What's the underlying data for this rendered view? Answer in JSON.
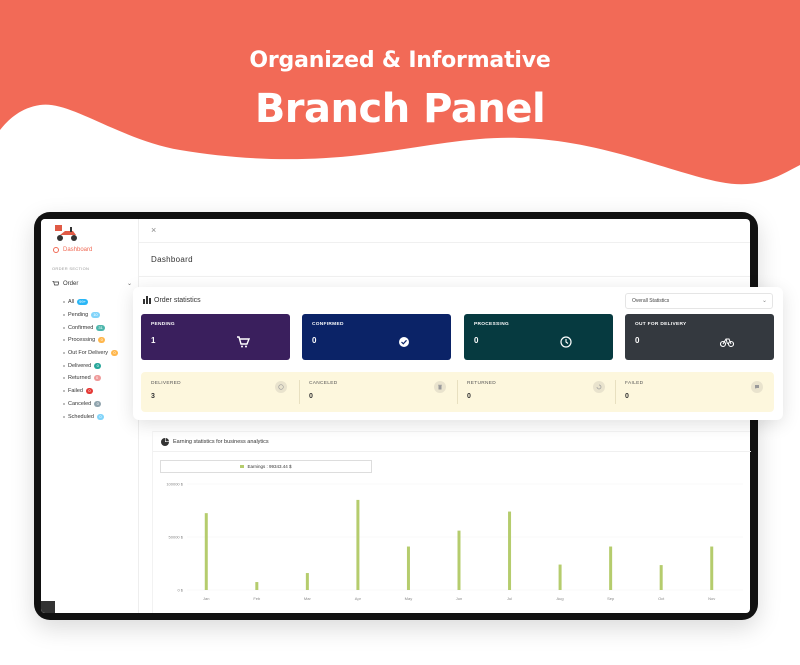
{
  "hero": {
    "subtitle": "Organized & Informative",
    "title": "Branch Panel"
  },
  "colors": {
    "brand": "#f26a57",
    "pending": "#3a1f5d",
    "confirmed": "#0b2367",
    "processing": "#063a40",
    "out_for_delivery": "#34393f",
    "soft_bg": "#fdf7dd",
    "bar": "#b5cc6d"
  },
  "sidebar": {
    "dashboard": "Dashboard",
    "section": "ORDER SECTION",
    "order": "Order",
    "items": [
      {
        "label": "All",
        "badge": "99+",
        "color": "#29b6f6"
      },
      {
        "label": "Pending",
        "badge": "10",
        "color": "#81d4fa"
      },
      {
        "label": "Confirmed",
        "badge": "31",
        "color": "#4db6ac"
      },
      {
        "label": "Processing",
        "badge": "0",
        "color": "#ffb74d"
      },
      {
        "label": "Out For Delivery",
        "badge": "0",
        "color": "#ffb74d"
      },
      {
        "label": "Delivered",
        "badge": "0",
        "color": "#26a69a"
      },
      {
        "label": "Returned",
        "badge": "0",
        "color": "#ef9a9a"
      },
      {
        "label": "Failed",
        "badge": "0",
        "color": "#e53935"
      },
      {
        "label": "Canceled",
        "badge": "0",
        "color": "#90a4ae"
      },
      {
        "label": "Scheduled",
        "badge": "0",
        "color": "#81d4fa"
      }
    ]
  },
  "topbar": {
    "close": "×"
  },
  "page_title": "Dashboard",
  "stats": {
    "title": "Order statistics",
    "select": "Overall Statistics",
    "tiles": [
      {
        "label": "PENDING",
        "value": "1",
        "icon": "cart-icon"
      },
      {
        "label": "CONFIRMED",
        "value": "0",
        "icon": "check-circle-icon"
      },
      {
        "label": "PROCESSING",
        "value": "0",
        "icon": "clock-icon"
      },
      {
        "label": "OUT FOR DELIVERY",
        "value": "0",
        "icon": "bicycle-icon"
      }
    ],
    "lower": [
      {
        "label": "DELIVERED",
        "value": "3",
        "icon": "check-icon"
      },
      {
        "label": "CANCELED",
        "value": "0",
        "icon": "trash-icon"
      },
      {
        "label": "RETURNED",
        "value": "0",
        "icon": "return-icon"
      },
      {
        "label": "FAILED",
        "value": "0",
        "icon": "message-icon"
      }
    ]
  },
  "earning": {
    "title": "Earning statistics for business analytics",
    "legend": "Earnings : 99343.44 $"
  },
  "chart_data": {
    "type": "bar",
    "categories": [
      "Jan",
      "Feb",
      "Mar",
      "Apr",
      "May",
      "Jun",
      "Jul",
      "Aug",
      "Sep",
      "Oct",
      "Nov"
    ],
    "series": [
      {
        "values": [
          14500,
          1500,
          3200,
          17000,
          8200,
          11200,
          14800,
          4800,
          8200,
          4700,
          8200
        ]
      }
    ],
    "yticks": [
      "100000 $",
      "50000 $",
      "0 $"
    ],
    "ylim": [
      0,
      20000
    ],
    "xlabel": "",
    "ylabel": "",
    "grid": true
  }
}
